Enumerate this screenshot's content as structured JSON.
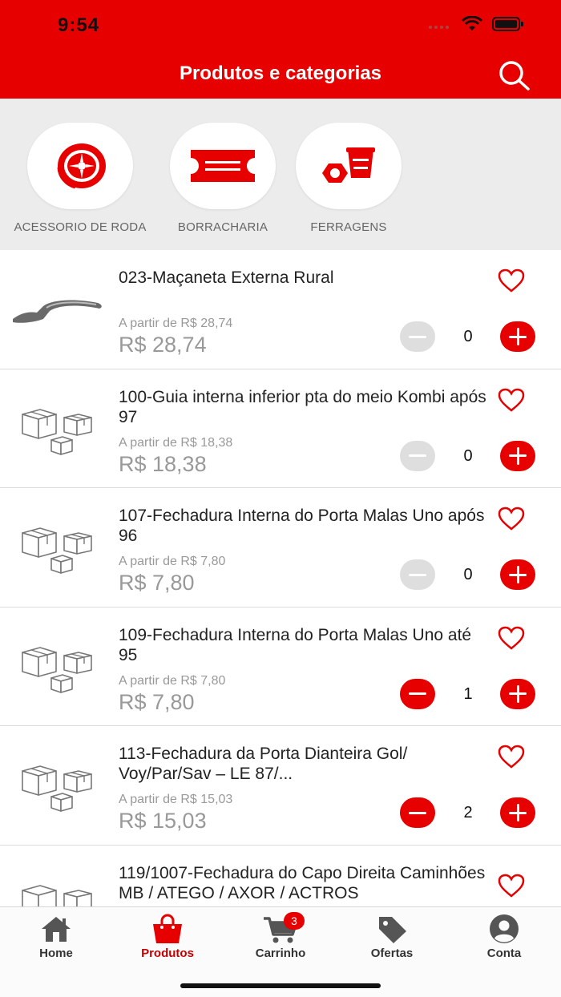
{
  "status_bar": {
    "time": "9:54"
  },
  "header": {
    "title": "Produtos e categorias",
    "search_icon": "search-icon"
  },
  "categories": [
    {
      "label": "ACESSORIO DE RODA",
      "icon": "wheel-icon"
    },
    {
      "label": "BORRACHARIA",
      "icon": "tire-patch-icon"
    },
    {
      "label": "FERRAGENS",
      "icon": "hardware-icon"
    }
  ],
  "products": [
    {
      "name": "023-Maçaneta Externa Rural",
      "from_label": "A partir de R$ 28,74",
      "price": "R$ 28,74",
      "quantity": "0",
      "thumb": "door-handle-image"
    },
    {
      "name": "100-Guia interna inferior pta do meio Kombi após 97",
      "from_label": "A partir de R$ 18,38",
      "price": "R$ 18,38",
      "quantity": "0",
      "thumb": "boxes-placeholder-icon"
    },
    {
      "name": "107-Fechadura Interna do Porta Malas Uno após 96",
      "from_label": "A partir de R$ 7,80",
      "price": "R$ 7,80",
      "quantity": "0",
      "thumb": "boxes-placeholder-icon"
    },
    {
      "name": "109-Fechadura Interna do Porta Malas Uno até 95",
      "from_label": "A partir de R$ 7,80",
      "price": "R$ 7,80",
      "quantity": "1",
      "thumb": "boxes-placeholder-icon"
    },
    {
      "name": "113-Fechadura da Porta Dianteira Gol/ Voy/Par/Sav – LE 87/...",
      "from_label": "A partir de R$ 15,03",
      "price": "R$ 15,03",
      "quantity": "2",
      "thumb": "boxes-placeholder-icon"
    },
    {
      "name": "119/1007-Fechadura do Capo Direita Caminhões MB / ATEGO / AXOR / ACTROS",
      "from_label": "",
      "price": "",
      "quantity": "",
      "thumb": "boxes-placeholder-icon"
    }
  ],
  "tabbar": {
    "tabs": [
      {
        "label": "Home",
        "icon": "home-icon"
      },
      {
        "label": "Produtos",
        "icon": "shopping-bag-icon",
        "active": true
      },
      {
        "label": "Carrinho",
        "icon": "cart-icon",
        "badge": "3"
      },
      {
        "label": "Ofertas",
        "icon": "tag-icon"
      },
      {
        "label": "Conta",
        "icon": "user-icon"
      }
    ]
  },
  "colors": {
    "brand_red": "#e60000",
    "category_bg": "#ececec",
    "muted_text": "#999999"
  }
}
